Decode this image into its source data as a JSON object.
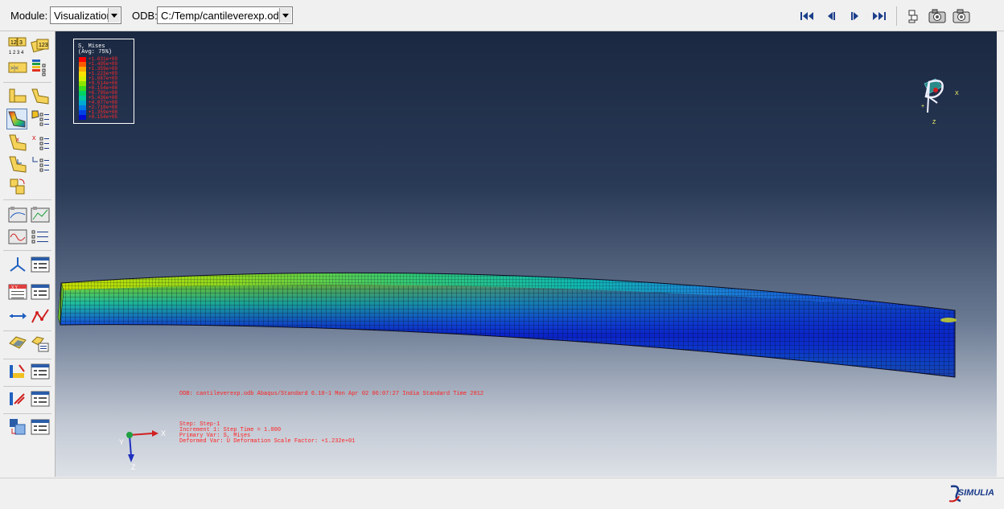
{
  "toolbar": {
    "module_label": "Module:",
    "module_value": "Visualization",
    "odb_label": "ODB:",
    "odb_value": "C:/Temp/cantileverexp.odb",
    "playback_icons": [
      "first-frame-icon",
      "previous-frame-icon",
      "next-frame-icon",
      "last-frame-icon"
    ],
    "view_icons": [
      "viewport-layout-icon",
      "camera-movie-icon",
      "camera-icon"
    ]
  },
  "legend": {
    "title_line1": "S, Mises",
    "title_line2": "(Avg: 75%)",
    "values": [
      "+1.631e+09",
      "+1.495e+09",
      "+1.359e+09",
      "+1.223e+09",
      "+1.087e+09",
      "+9.514e+08",
      "+8.154e+08",
      "+6.795e+08",
      "+5.436e+08",
      "+4.077e+08",
      "+2.718e+08",
      "+1.359e+08",
      "+8.154e+05"
    ],
    "colors": [
      "#ff0000",
      "#ff5a00",
      "#ffaa00",
      "#ffe100",
      "#d8f000",
      "#8ce600",
      "#3cdc1e",
      "#00d264",
      "#00c8a0",
      "#00aad2",
      "#0078e6",
      "#0041e6",
      "#000ad2"
    ]
  },
  "info": {
    "odb_line": "ODB: cantileverexp.odb    Abaqus/Standard 6.10-1    Mon Apr 02 06:07:27 India Standard Time 2012",
    "step": "Step: Step-1",
    "increment": "Increment      1: Step Time =     1.000",
    "primary": "Primary Var: S, Mises",
    "deformed": "Deformed Var: U   Deformation Scale Factor: +1.232e+01"
  },
  "triad": {
    "x": "X",
    "y": "Y",
    "z": "Z"
  },
  "compass": {
    "x": "X",
    "z": "Z"
  },
  "brand": "SIMULIA"
}
